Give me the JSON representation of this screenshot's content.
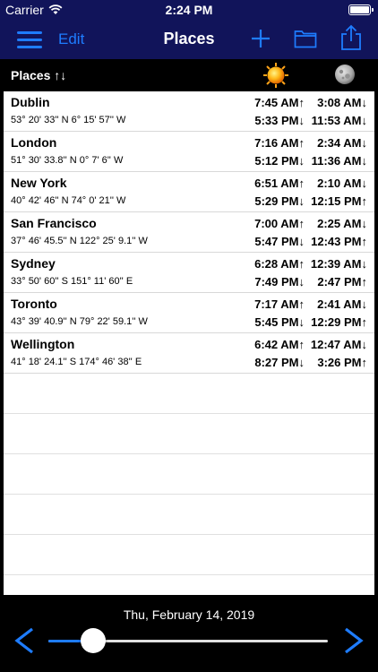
{
  "status_bar": {
    "carrier": "Carrier",
    "time": "2:24 PM"
  },
  "nav": {
    "edit_label": "Edit",
    "title": "Places",
    "icons": [
      "menu-icon",
      "plus-icon",
      "folder-icon",
      "share-icon"
    ]
  },
  "header": {
    "places_label": "Places ↑↓",
    "sun_icon": "sun-icon",
    "moon_icon": "moon-icon"
  },
  "places": [
    {
      "name": "Dublin",
      "coords": "53° 20' 33'' N  6° 15' 57'' W",
      "sunrise": "7:45 AM↑",
      "sunset": "5:33 PM↓",
      "moonrise": "3:08 AM↓",
      "moonset": "11:53 AM↓"
    },
    {
      "name": "London",
      "coords": "51° 30' 33.8'' N  0° 7' 6'' W",
      "sunrise": "7:16 AM↑",
      "sunset": "5:12 PM↓",
      "moonrise": "2:34 AM↓",
      "moonset": "11:36 AM↓"
    },
    {
      "name": "New York",
      "coords": "40° 42' 46'' N  74° 0' 21'' W",
      "sunrise": "6:51 AM↑",
      "sunset": "5:29 PM↓",
      "moonrise": "2:10 AM↓",
      "moonset": "12:15 PM↑"
    },
    {
      "name": "San Francisco",
      "coords": "37° 46' 45.5'' N  122° 25' 9.1'' W",
      "sunrise": "7:00 AM↑",
      "sunset": "5:47 PM↓",
      "moonrise": "2:25 AM↓",
      "moonset": "12:43 PM↑"
    },
    {
      "name": "Sydney",
      "coords": "33° 50' 60'' S  151° 11' 60'' E",
      "sunrise": "6:28 AM↑",
      "sunset": "7:49 PM↓",
      "moonrise": "12:39 AM↓",
      "moonset": "2:47 PM↑"
    },
    {
      "name": "Toronto",
      "coords": "43° 39' 40.9'' N  79° 22' 59.1'' W",
      "sunrise": "7:17 AM↑",
      "sunset": "5:45 PM↓",
      "moonrise": "2:41 AM↓",
      "moonset": "12:29 PM↑"
    },
    {
      "name": "Wellington",
      "coords": "41° 18' 24.1'' S  174° 46' 38'' E",
      "sunrise": "6:42 AM↑",
      "sunset": "8:27 PM↓",
      "moonrise": "12:47 AM↓",
      "moonset": "3:26 PM↑"
    }
  ],
  "footer": {
    "date": "Thu, February 14, 2019",
    "prev_label": "<",
    "next_label": ">",
    "slider_value": 0.16
  },
  "colors": {
    "nav_bg": "#11145a",
    "accent": "#1e7cff",
    "list_bg": "#ffffff",
    "background": "#000000"
  }
}
